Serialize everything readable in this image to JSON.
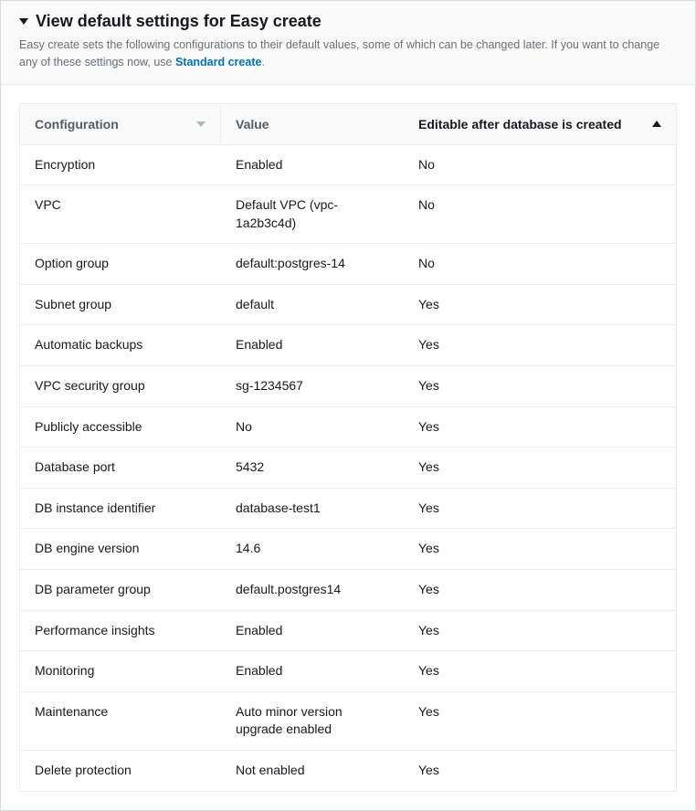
{
  "header": {
    "title": "View default settings for Easy create",
    "description_pre": "Easy create sets the following configurations to their default values, some of which can be changed later. If you want to change any of these settings now, use ",
    "description_link": "Standard create",
    "description_post": "."
  },
  "table": {
    "columns": {
      "config": "Configuration",
      "value": "Value",
      "editable": "Editable after database is created"
    },
    "rows": [
      {
        "config": "Encryption",
        "value": "Enabled",
        "editable": "No"
      },
      {
        "config": "VPC",
        "value": "Default VPC (vpc-1a2b3c4d)",
        "editable": "No"
      },
      {
        "config": "Option group",
        "value": "default:postgres-14",
        "editable": "No"
      },
      {
        "config": "Subnet group",
        "value": "default",
        "editable": "Yes"
      },
      {
        "config": "Automatic backups",
        "value": "Enabled",
        "editable": "Yes"
      },
      {
        "config": "VPC security group",
        "value": "sg-1234567",
        "editable": "Yes"
      },
      {
        "config": "Publicly accessible",
        "value": "No",
        "editable": "Yes"
      },
      {
        "config": "Database port",
        "value": "5432",
        "editable": "Yes"
      },
      {
        "config": "DB instance identifier",
        "value": "database-test1",
        "editable": "Yes"
      },
      {
        "config": "DB engine version",
        "value": "14.6",
        "editable": "Yes"
      },
      {
        "config": "DB parameter group",
        "value": "default.postgres14",
        "editable": "Yes"
      },
      {
        "config": "Performance insights",
        "value": "Enabled",
        "editable": "Yes"
      },
      {
        "config": "Monitoring",
        "value": "Enabled",
        "editable": "Yes"
      },
      {
        "config": "Maintenance",
        "value": "Auto minor version upgrade enabled",
        "editable": "Yes"
      },
      {
        "config": "Delete protection",
        "value": "Not enabled",
        "editable": "Yes"
      }
    ]
  }
}
